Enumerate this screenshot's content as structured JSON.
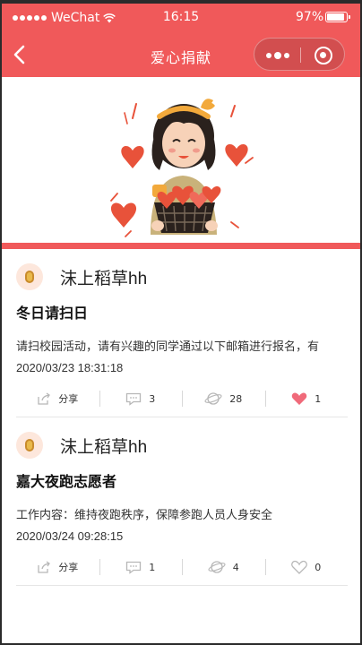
{
  "status_bar": {
    "carrier": "WeChat",
    "time": "16:15",
    "battery": "97%",
    "battery_level": 0.97
  },
  "nav": {
    "title": "爱心捐献"
  },
  "colors": {
    "accent": "#f0595a",
    "like": "#f06a7a"
  },
  "posts": [
    {
      "author": "沫上稻草hh",
      "title": "冬日请扫日",
      "body": "请扫校园活动，请有兴趣的同学通过以下邮箱进行报名，有",
      "date": "2020/03/23 18:31:18",
      "share_label": "分享",
      "comments": "3",
      "views": "28",
      "likes": "1",
      "liked": true
    },
    {
      "author": "沫上稻草hh",
      "title": "嘉大夜跑志愿者",
      "body": "工作内容：维持夜跑秩序，保障参跑人员人身安全",
      "date": "2020/03/24 09:28:15",
      "share_label": "分享",
      "comments": "1",
      "views": "4",
      "likes": "0",
      "liked": false
    }
  ]
}
